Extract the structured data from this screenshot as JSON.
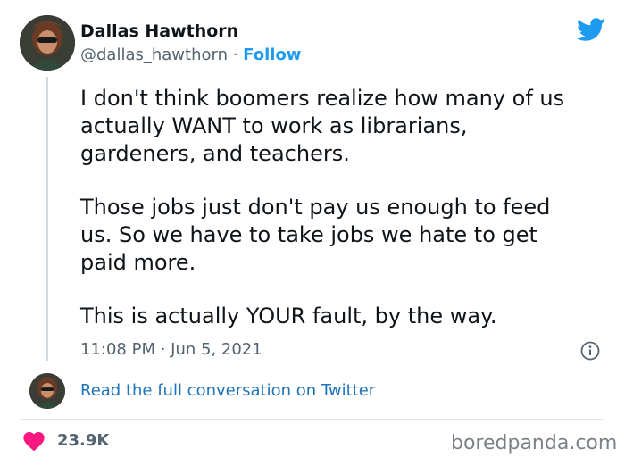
{
  "tweet": {
    "author_name": "Dallas Hawthorn",
    "handle": "@dallas_hawthorn",
    "separator": " · ",
    "follow_label": "Follow",
    "paragraphs": [
      [
        "I don't think boomers realize how many of us",
        "actually WANT to work as librarians,",
        "gardeners, and teachers."
      ],
      [
        "Those jobs just don't pay us enough to feed",
        "us. So we have to take jobs we hate to get",
        "paid more."
      ],
      [
        "This is actually YOUR fault, by the way."
      ]
    ],
    "timestamp": "11:08 PM · Jun 5, 2021",
    "read_conversation_label": "Read the full conversation on Twitter",
    "likes": "23.9K"
  },
  "icons": {
    "brand": "twitter-bird-icon",
    "info": "info-icon",
    "like": "heart-icon"
  },
  "colors": {
    "accent": "#1d9bf0",
    "heart": "#f91880",
    "muted": "#536471"
  },
  "watermark": "boredpanda.com"
}
